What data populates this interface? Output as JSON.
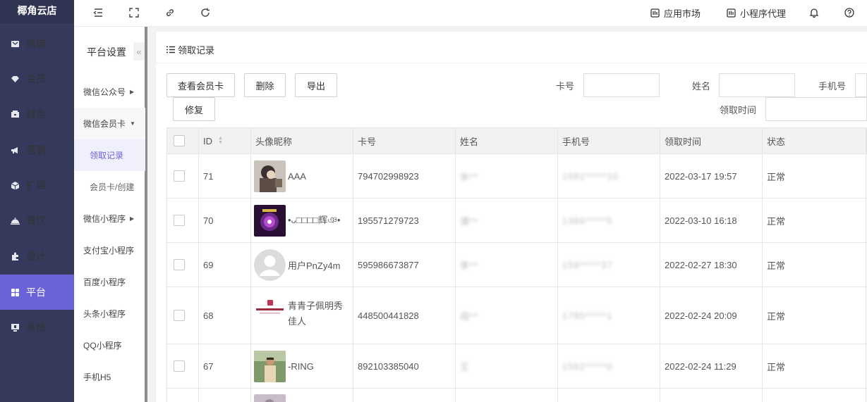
{
  "app": {
    "title": "椰角云店"
  },
  "sidebar": {
    "items": [
      {
        "label": "商城",
        "icon": "shop-icon"
      },
      {
        "label": "会员",
        "icon": "member-icon"
      },
      {
        "label": "财务",
        "icon": "finance-icon"
      },
      {
        "label": "营销",
        "icon": "marketing-icon"
      },
      {
        "label": "扩展",
        "icon": "extend-icon"
      },
      {
        "label": "餐饮",
        "icon": "catering-icon"
      },
      {
        "label": "设计",
        "icon": "design-icon"
      },
      {
        "label": "平台",
        "icon": "platform-icon",
        "active": true
      },
      {
        "label": "系统",
        "icon": "system-icon"
      }
    ]
  },
  "topbar": {
    "app_market": "应用市场",
    "mini_agent": "小程序代理"
  },
  "subside": {
    "title": "平台设置",
    "items": [
      {
        "label": "微信公众号"
      },
      {
        "label": "微信会员卡"
      },
      {
        "label": "领取记录"
      },
      {
        "label": "会员卡/创建"
      },
      {
        "label": "微信小程序"
      },
      {
        "label": "支付宝小程序"
      },
      {
        "label": "百度小程序"
      },
      {
        "label": "头条小程序"
      },
      {
        "label": "QQ小程序"
      },
      {
        "label": "手机H5"
      }
    ]
  },
  "panel": {
    "title": "领取记录",
    "buttons": {
      "view_card": "查看会员卡",
      "delete": "删除",
      "export": "导出",
      "repair": "修复"
    },
    "filters": {
      "card_no": "卡号",
      "name": "姓名",
      "phone": "手机号",
      "receive_time": "领取时间"
    }
  },
  "table": {
    "headers": [
      "ID",
      "头像昵称",
      "卡号",
      "姓名",
      "手机号",
      "领取时间",
      "状态"
    ],
    "rows": [
      {
        "id": "71",
        "nick": "AAA",
        "card": "794702998923",
        "name": "余**",
        "phone": "1581*****10",
        "time": "2022-03-17 19:57",
        "status": "正常"
      },
      {
        "id": "70",
        "nick": "•ᴗ□□□□辉ঞ•",
        "card": "195571279723",
        "name": "谭**",
        "phone": "1366*****5",
        "time": "2022-03-10 16:18",
        "status": "正常"
      },
      {
        "id": "69",
        "nick": "用户PnZy4m",
        "card": "595986673877",
        "name": "李**",
        "phone": "159*****37",
        "time": "2022-02-27 18:30",
        "status": "正常"
      },
      {
        "id": "68",
        "nick": "青青子佩明秀佳人",
        "card": "448500441828",
        "name": "阎**",
        "phone": "1785*****1",
        "time": "2022-02-24 20:09",
        "status": "正常"
      },
      {
        "id": "67",
        "nick": "-RING",
        "card": "892103385040",
        "name": "王",
        "phone": "1562*****0",
        "time": "2022-02-24 11:29",
        "status": "正常"
      }
    ]
  },
  "colors": {
    "sidebar_bg": "#353a5c",
    "accent": "#6a63d8"
  }
}
